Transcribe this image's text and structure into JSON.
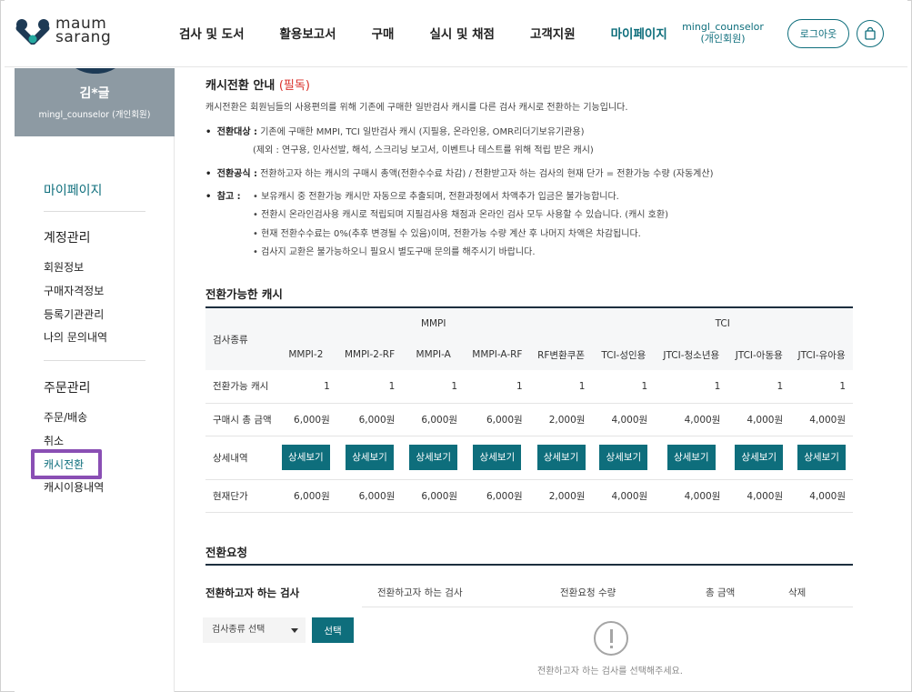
{
  "header": {
    "logo_line1": "maum",
    "logo_line2": "sarang",
    "nav": [
      "검사 및 도서",
      "활용보고서",
      "구매",
      "실시 및 채점",
      "고객지원",
      "마이페이지"
    ],
    "user_id": "mingl_counselor",
    "user_type": "(개인회원)",
    "logout_label": "로그아웃"
  },
  "sidebar": {
    "name": "김*글",
    "id_line": "mingl_counselor (개인회원)",
    "title": "마이페이지",
    "groups": [
      {
        "label": "계정관리",
        "items": [
          "회원정보",
          "구매자격정보",
          "등록기관관리",
          "나의 문의내역"
        ]
      },
      {
        "label": "주문관리",
        "items": [
          "주문/배송",
          "취소",
          "캐시전환",
          "캐시이용내역"
        ]
      }
    ],
    "active_item": "캐시전환"
  },
  "notice": {
    "title": "캐시전환 안내",
    "required": "(필독)",
    "desc": "캐시전환은 회원님들의 사용편의를 위해 기존에 구매한 일반검사 캐시를 다른 검사 캐시로 전환하는 기능입니다.",
    "target_label": "전환대상 :",
    "target_text": "기존에 구매한 MMPI, TCI 일반검사 캐시 (지필용, 온라인용, OMR리더기보유기관용)",
    "target_exclude": "(제외 : 연구용, 인사선발, 해석, 스크리닝 보고서, 이벤트나 테스트를 위해 적립 받은 캐시)",
    "formula_label": "전환공식 :",
    "formula_text": "전환하고자 하는 캐시의 구매시 총액(전환수수료 차감) / 전환받고자 하는 검사의 현재 단가 = 전환가능 수량 (자동계산)",
    "ref_label": "참고 :",
    "refs": [
      "• 보유캐시 중 전환가능 캐시만 자동으로 추출되며, 전환과정에서 차액추가 입금은 불가능합니다.",
      "• 전환시 온라인검사용 캐시로 적립되며 지필검사용 채점과 온라인 검사 모두 사용할 수 있습니다. (캐시 호환)",
      "• 현재 전환수수료는 0%(추후 변경될 수 있음)이며, 전환가능 수량 계산 후 나머지 차액은 차감됩니다.",
      "• 검사지 교환은 불가능하오니 필요시 별도구매 문의를 해주시기 바랍니다."
    ]
  },
  "cash_table": {
    "title": "전환가능한 캐시",
    "corner_label": "검사종류",
    "group_mmpi": "MMPI",
    "group_tci": "TCI",
    "columns": [
      "MMPI-2",
      "MMPI-2-RF",
      "MMPI-A",
      "MMPI-A-RF",
      "RF변환쿠폰",
      "TCI-성인용",
      "JTCI-청소년용",
      "JTCI-아동용",
      "JTCI-유아용"
    ],
    "row_labels": {
      "available": "전환가능 캐시",
      "total": "구매시 총 금액",
      "detail": "상세내역",
      "price": "현재단가"
    },
    "available": [
      "1",
      "1",
      "1",
      "1",
      "1",
      "1",
      "1",
      "1",
      "1"
    ],
    "total": [
      "6,000원",
      "6,000원",
      "6,000원",
      "6,000원",
      "2,000원",
      "4,000원",
      "4,000원",
      "4,000원",
      "4,000원"
    ],
    "detail_label": "상세보기",
    "price": [
      "6,000원",
      "6,000원",
      "6,000원",
      "6,000원",
      "2,000원",
      "4,000원",
      "4,000원",
      "4,000원",
      "4,000원"
    ]
  },
  "request": {
    "title": "전환요청",
    "left_title": "전환하고자 하는 검사",
    "col_test": "전환하고자 하는 검사",
    "col_qty": "전환요청 수량",
    "col_total": "총 금액",
    "col_delete": "삭제",
    "select_value": "검사종류 선택",
    "select_btn": "선택",
    "empty_msg": "전환하고자 하는 검사를 선택해주세요."
  },
  "colors": {
    "accent": "#0e6e7c",
    "required": "#d9312b",
    "highlight": "#8a4fb4"
  }
}
